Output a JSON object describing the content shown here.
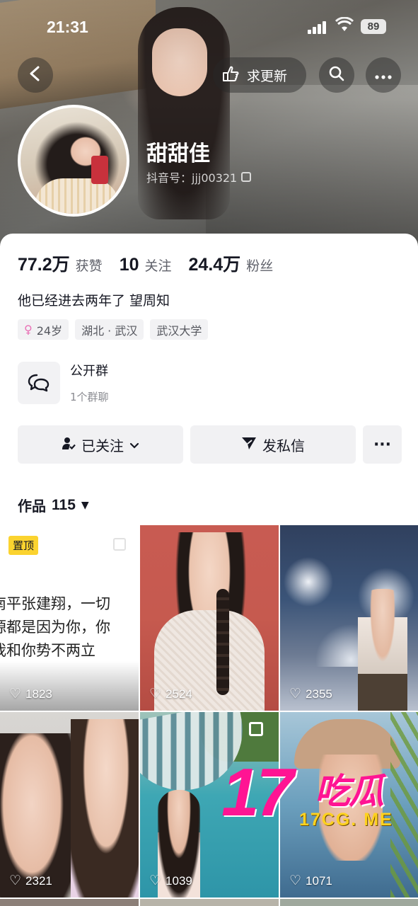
{
  "status_bar": {
    "time": "21:31",
    "battery": "89"
  },
  "header": {
    "update_label": "求更新",
    "icons": {
      "back": "chevron-left-icon",
      "search": "search-icon",
      "more": "more-icon",
      "update": "hand-point-icon"
    }
  },
  "profile": {
    "nickname": "甜甜佳",
    "douyin_id": "抖音号：jjj00321",
    "stats": [
      {
        "value": "77.2万",
        "label": "获赞"
      },
      {
        "value": "10",
        "label": "关注"
      },
      {
        "value": "24.4万",
        "label": "粉丝"
      }
    ],
    "bio": "他已经进去两年了 望周知",
    "tags": [
      {
        "text": "24岁",
        "icon": "female-icon"
      },
      {
        "text": "湖北 · 武汉"
      },
      {
        "text": "武汉大学"
      }
    ],
    "group": {
      "title": "公开群",
      "subtitle": "1个群聊"
    }
  },
  "actions": {
    "follow_label": "已关注",
    "message_label": "发私信",
    "more_label": "···"
  },
  "works": {
    "tab_label": "作品",
    "count": "115"
  },
  "posts": [
    {
      "pinned_label": "置顶",
      "text_lines": [
        "南平张建翔，一切",
        "源都是因为你，你",
        "我和你势不两立"
      ],
      "likes": "1823"
    },
    {
      "likes": "2524"
    },
    {
      "likes": "2355"
    },
    {
      "likes": "2321"
    },
    {
      "likes": "1039"
    },
    {
      "likes": "1071"
    }
  ],
  "watermark": {
    "number": "17",
    "chinese": "吃瓜",
    "url": "17CG. ME"
  },
  "colors": {
    "accent_pink": "#ff1493",
    "watermark_yellow": "#ffd21f",
    "pin_badge": "#fbd32f",
    "text_primary": "#161823",
    "text_secondary": "#60626b"
  }
}
